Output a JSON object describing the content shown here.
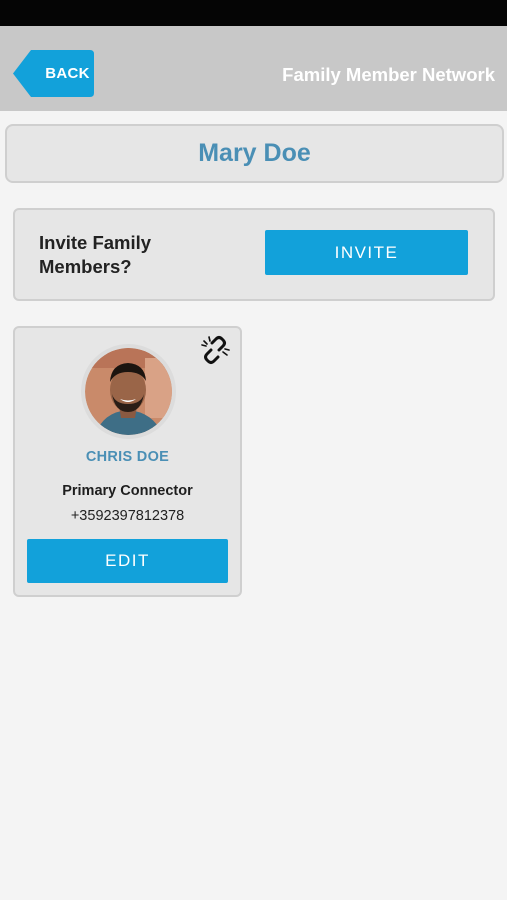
{
  "header": {
    "back_label": "BACK",
    "title": "Family Member Network"
  },
  "profile": {
    "name": "Mary Doe"
  },
  "invite": {
    "prompt": "Invite Family Members?",
    "button_label": "INVITE"
  },
  "members": [
    {
      "name": "CHRIS DOE",
      "role": "Primary Connector",
      "phone": "+3592397812378",
      "edit_label": "EDIT",
      "action_icon": "unlink-icon"
    }
  ],
  "colors": {
    "status_bar": "#050505",
    "header_bg": "#c8c8c8",
    "accent_button": "#12a1da",
    "name_text": "#4a8fb5",
    "card_bg": "#e6e6e6",
    "page_bg": "#f4f4f4"
  }
}
